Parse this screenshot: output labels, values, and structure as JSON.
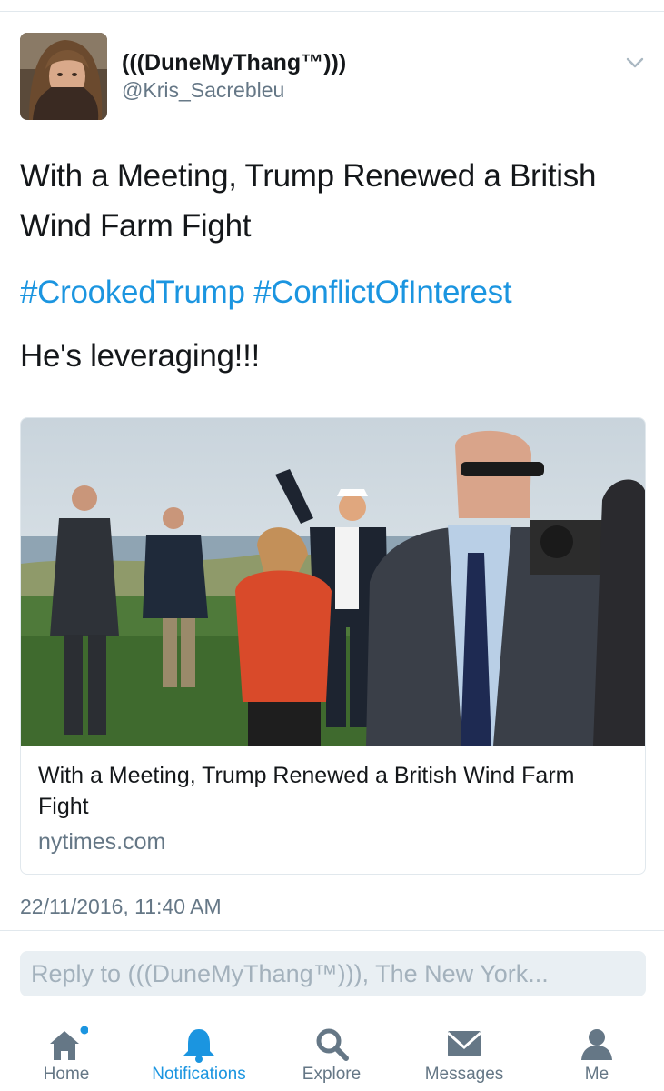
{
  "tweet": {
    "display_name": "(((DuneMyThang™)))",
    "handle": "@Kris_Sacrebleu",
    "text_line_1": "With a Meeting, Trump Renewed a British Wind Farm Fight",
    "hashtag_1": "#CrookedTrump",
    "hashtag_2": "#ConflictOfInterest",
    "text_line_3": "He's leveraging!!!",
    "timestamp": "22/11/2016, 11:40 AM"
  },
  "card": {
    "title": "With a Meeting, Trump Renewed a British Wind Farm Fight",
    "domain": "nytimes.com"
  },
  "reply": {
    "placeholder": "Reply to (((DuneMyThang™))), The New York..."
  },
  "tabbar": {
    "items": [
      {
        "label": "Home",
        "icon": "home-icon",
        "has_badge": true
      },
      {
        "label": "Notifications",
        "icon": "bell-icon",
        "active": true
      },
      {
        "label": "Explore",
        "icon": "search-icon"
      },
      {
        "label": "Messages",
        "icon": "envelope-icon"
      },
      {
        "label": "Me",
        "icon": "person-icon"
      }
    ]
  },
  "colors": {
    "accent": "#1b95e0",
    "text": "#14171a",
    "secondary_text": "#657786",
    "border": "#e1e8ed",
    "reply_background": "#e9eff3"
  }
}
